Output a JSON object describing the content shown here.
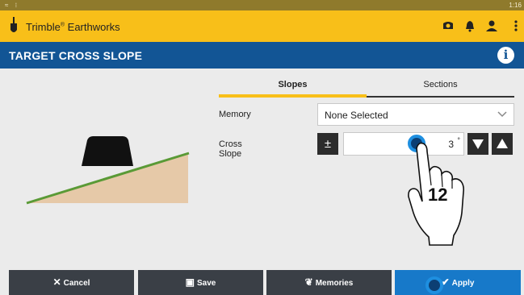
{
  "status_bar": {
    "icons_left": "wifi-icon battery-icon",
    "time": "1:16"
  },
  "app_bar": {
    "app_name": "Trimble",
    "reg_mark": "®",
    "app_name_suffix": " Earthworks",
    "icons": [
      "camera-icon",
      "bell-icon",
      "user-icon",
      "kebab-menu-icon"
    ]
  },
  "title_bar": {
    "title": "TARGET CROSS SLOPE",
    "info_icon": "i"
  },
  "tabs": [
    {
      "label": "Slopes",
      "selected": true
    },
    {
      "label": "Sections",
      "selected": false
    }
  ],
  "form": {
    "memory_label": "Memory",
    "memory_value": "None Selected",
    "cross_slope_label": "Cross Slope",
    "plus_minus_label": "±",
    "cross_slope_value": "3",
    "cross_slope_unit": "°"
  },
  "callout_number": "12",
  "buttons": {
    "cancel": "Cancel",
    "save": "Save",
    "memories": "Memories",
    "apply": "Apply"
  },
  "colors": {
    "status_bar": "#8f7a2c",
    "app_bar": "#f8bf19",
    "title_bar": "#125595",
    "content_bg": "#ebebeb",
    "slope_fill": "#e6c9a8",
    "slope_line": "#5a9a36",
    "dark_button": "#3a3f46",
    "apply_button": "#1779c9",
    "touch_marker": "#1e8fe0"
  }
}
